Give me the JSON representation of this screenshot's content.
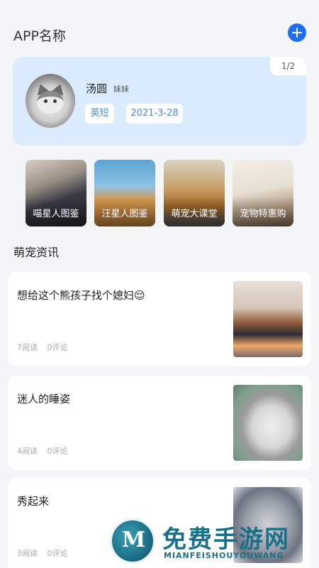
{
  "header": {
    "app_title": "APP名称"
  },
  "pet_card": {
    "page_indicator": "1/2",
    "name": "汤圆",
    "gender": "妹妹",
    "breed": "英短",
    "birth_date": "2021-3-28"
  },
  "quick_links": [
    {
      "label": "喵星人图鉴"
    },
    {
      "label": "汪星人图鉴"
    },
    {
      "label": "萌宠大课堂"
    },
    {
      "label": "宠物特惠购"
    }
  ],
  "news_section": {
    "title": "萌宠资讯",
    "items": [
      {
        "title": "想给这个熊孩子找个媳妇😌",
        "reads": "7阅读",
        "comments": "0评论"
      },
      {
        "title": "迷人的睡姿",
        "reads": "4阅读",
        "comments": "0评论"
      },
      {
        "title": "秀起来",
        "reads": "3阅读",
        "comments": "0评论"
      }
    ]
  },
  "watermark": {
    "cn": "免费手游网",
    "en": "MIANFEISHOUYOUWANG"
  },
  "colors": {
    "accent": "#1e6ff1",
    "card_bg": "#d9ebfd",
    "chip_text": "#4a8ad8",
    "page_bg": "#f4f5f7"
  }
}
